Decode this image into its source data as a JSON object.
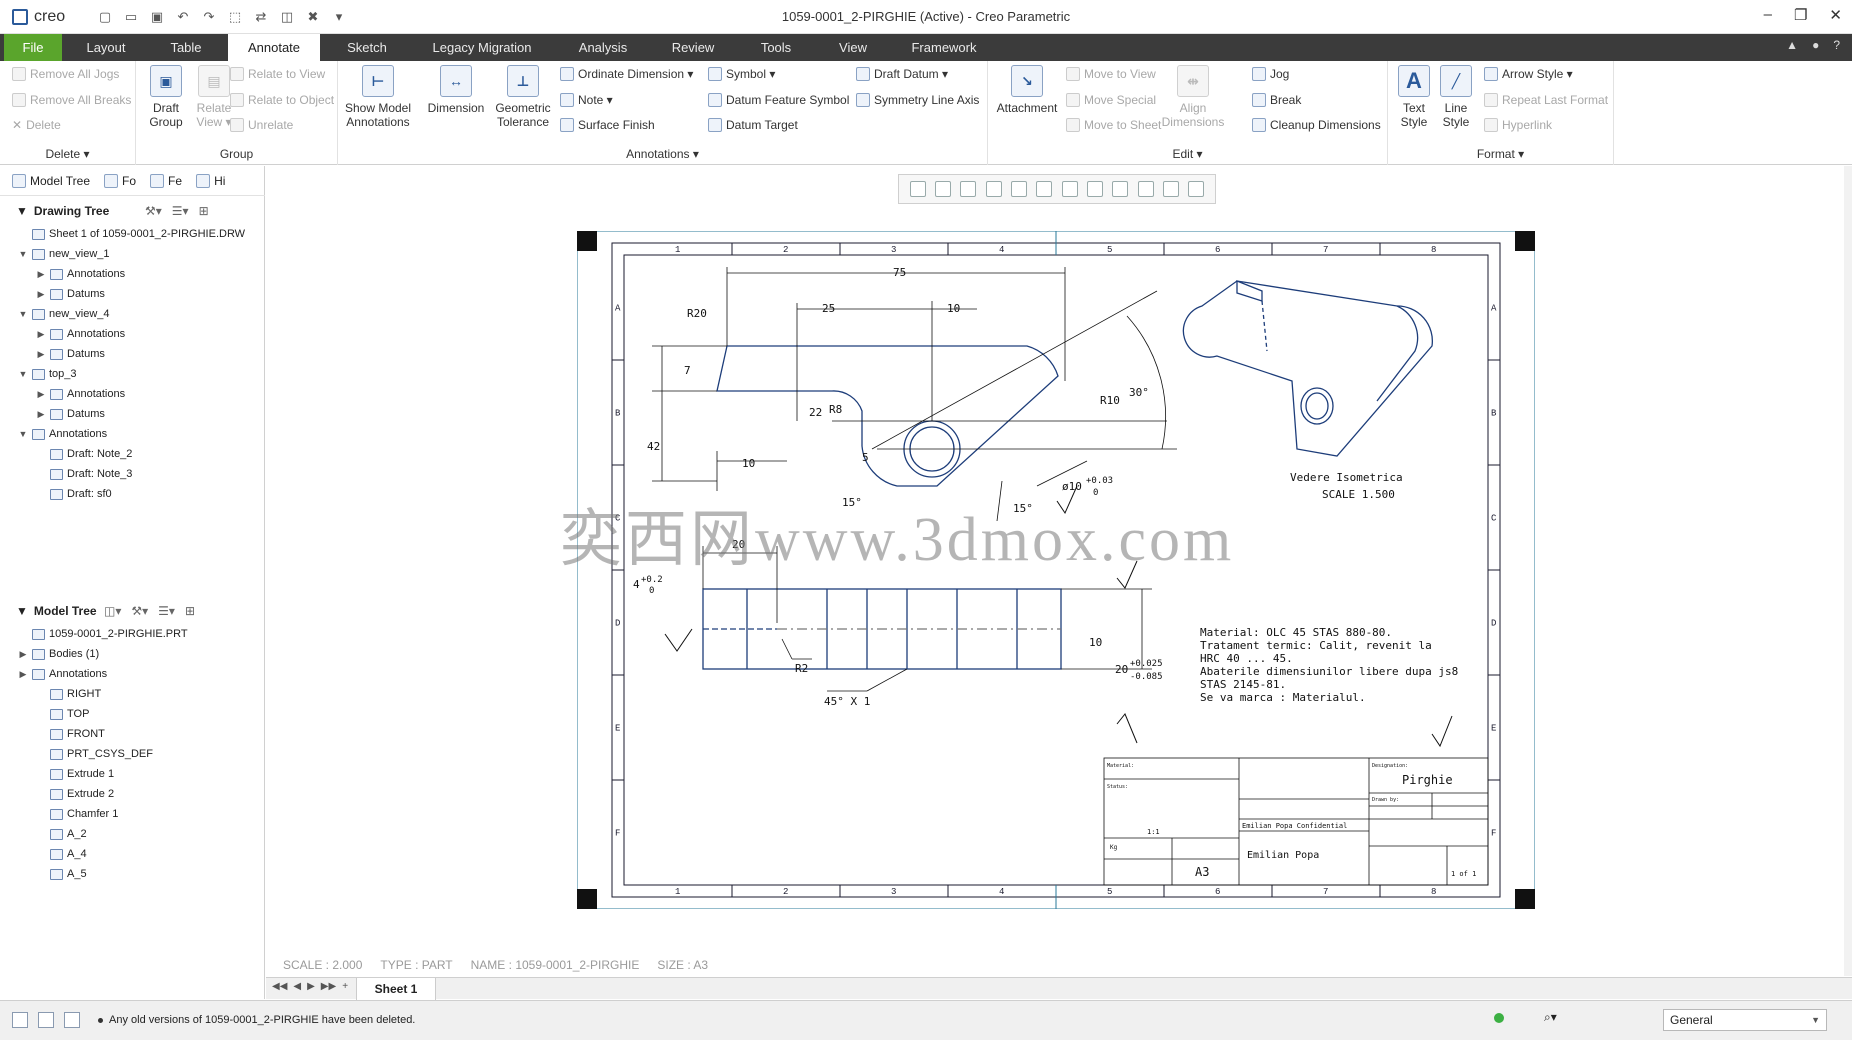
{
  "app": {
    "logo": "creo",
    "window_title": "1059-0001_2-PIRGHIE (Active) - Creo Parametric",
    "window_controls": [
      "–",
      "❐",
      "✕"
    ]
  },
  "tabs": [
    {
      "label": "File"
    },
    {
      "label": "Layout"
    },
    {
      "label": "Table"
    },
    {
      "label": "Annotate"
    },
    {
      "label": "Sketch"
    },
    {
      "label": "Legacy Migration"
    },
    {
      "label": "Analysis"
    },
    {
      "label": "Review"
    },
    {
      "label": "Tools"
    },
    {
      "label": "View"
    },
    {
      "label": "Framework"
    }
  ],
  "ribbon": {
    "delete": {
      "label": "Delete ▾",
      "items": [
        "Remove All Jogs",
        "Remove All Breaks",
        "Delete"
      ]
    },
    "group": {
      "label": "Group",
      "draft_group": "Draft Group",
      "relate_view": "Relate View ▾",
      "items": [
        "Relate to View",
        "Relate to Object",
        "Unrelate"
      ]
    },
    "annotations": {
      "label": "Annotations ▾",
      "show_model_annotations": "Show Model Annotations",
      "dimension": "Dimension",
      "geometric_tolerance": "Geometric Tolerance",
      "col1": [
        "Ordinate Dimension ▾",
        "Note ▾",
        "Surface Finish"
      ],
      "col2": [
        "Symbol ▾",
        "Datum Feature Symbol",
        "Datum Target"
      ],
      "col3": [
        "Draft Datum ▾",
        "Symmetry Line Axis"
      ]
    },
    "edit": {
      "label": "Edit ▾",
      "attachment": "Attachment",
      "move_items": [
        "Move to View",
        "Move Special",
        "Move to Sheet"
      ],
      "align_dimensions": "Align Dimensions",
      "items": [
        "Jog",
        "Break",
        "Cleanup Dimensions"
      ]
    },
    "format": {
      "label": "Format ▾",
      "text_style": "Text Style",
      "line_style": "Line Style",
      "items": [
        "Arrow Style ▾",
        "Repeat Last Format",
        "Hyperlink"
      ]
    }
  },
  "left_panel": {
    "tabs": [
      "Model Tree",
      "Fo",
      "Fe",
      "Hi"
    ],
    "drawing_tree": {
      "title": "Drawing Tree",
      "nodes": [
        {
          "label": "Sheet 1 of 1059-0001_2-PIRGHIE.DRW",
          "level": 0,
          "exp": ""
        },
        {
          "label": "new_view_1",
          "level": 0,
          "exp": "▼"
        },
        {
          "label": "Annotations",
          "level": 1,
          "exp": "▶"
        },
        {
          "label": "Datums",
          "level": 1,
          "exp": "▶"
        },
        {
          "label": "new_view_4",
          "level": 0,
          "exp": "▼"
        },
        {
          "label": "Annotations",
          "level": 1,
          "exp": "▶"
        },
        {
          "label": "Datums",
          "level": 1,
          "exp": "▶"
        },
        {
          "label": "top_3",
          "level": 0,
          "exp": "▼"
        },
        {
          "label": "Annotations",
          "level": 1,
          "exp": "▶"
        },
        {
          "label": "Datums",
          "level": 1,
          "exp": "▶"
        },
        {
          "label": "Annotations",
          "level": 0,
          "exp": "▼"
        },
        {
          "label": "Draft: Note_2",
          "level": 1,
          "exp": ""
        },
        {
          "label": "Draft: Note_3",
          "level": 1,
          "exp": ""
        },
        {
          "label": "Draft: sf0",
          "level": 1,
          "exp": ""
        }
      ]
    },
    "model_tree": {
      "title": "Model Tree",
      "nodes": [
        {
          "label": "1059-0001_2-PIRGHIE.PRT",
          "level": 0,
          "exp": ""
        },
        {
          "label": "Bodies (1)",
          "level": 0,
          "exp": "▶"
        },
        {
          "label": "Annotations",
          "level": 0,
          "exp": "▶"
        },
        {
          "label": "RIGHT",
          "level": 1,
          "exp": ""
        },
        {
          "label": "TOP",
          "level": 1,
          "exp": ""
        },
        {
          "label": "FRONT",
          "level": 1,
          "exp": ""
        },
        {
          "label": "PRT_CSYS_DEF",
          "level": 1,
          "exp": ""
        },
        {
          "label": "Extrude 1",
          "level": 1,
          "exp": ""
        },
        {
          "label": "Extrude 2",
          "level": 1,
          "exp": ""
        },
        {
          "label": "Chamfer 1",
          "level": 1,
          "exp": ""
        },
        {
          "label": "A_2",
          "level": 1,
          "exp": ""
        },
        {
          "label": "A_4",
          "level": 1,
          "exp": ""
        },
        {
          "label": "A_5",
          "level": 1,
          "exp": ""
        }
      ]
    }
  },
  "drawing": {
    "zones_top": [
      "1",
      "2",
      "3",
      "4",
      "5",
      "6",
      "7",
      "8"
    ],
    "zones_side": [
      "A",
      "B",
      "C",
      "D",
      "E",
      "F"
    ],
    "dims": {
      "d75": "75",
      "d25": "25",
      "d10a": "10",
      "r20": "R20",
      "d7": "7",
      "d42": "42",
      "d22": "22",
      "r8": "R8",
      "d10b": "10",
      "d5": "5",
      "d15a": "15°",
      "d15b": "15°",
      "r10": "R10",
      "d30": "30°",
      "phi10": "ø10",
      "phi_tol_up": "+0.03",
      "phi_tol_lo": "0",
      "d20": "20",
      "d4": "4",
      "d4_tol_up": "+0.2",
      "d4_tol_lo": "0",
      "r2": "R2",
      "chamfer": "45° X 1",
      "d10c": "10",
      "d20b": "20",
      "d20b_tol_up": "+0.025",
      "d20b_tol_lo": "-0.085"
    },
    "iso_caption_1": "Vedere Isometrica",
    "iso_caption_2": "SCALE 1.500",
    "notes": [
      "Material: OLC 45 STAS 880-80.",
      "Tratament termic: Calit, revenit la",
      "HRC 40 ... 45.",
      "Abaterile dimensiunilor libere dupa js8",
      "STAS 2145-81.",
      "Se va marca : Materialul."
    ],
    "title_block": {
      "part_name": "Pirghie",
      "author": "Emilian Popa",
      "confidential": "Emilian Popa Confidential",
      "size": "A3",
      "sheet": "1 of 1",
      "scale": "1:1",
      "material_label": "Material:",
      "status_label": "Status:",
      "designation_label": "Designation:",
      "drawn_by_label": "Drawn by:",
      "weight": "Kg"
    }
  },
  "watermark": "奕西网www.3dmox.com",
  "model_info": {
    "scale": "SCALE : 2.000",
    "type": "TYPE : PART",
    "name": "NAME : 1059-0001_2-PIRGHIE",
    "size": "SIZE : A3"
  },
  "sheet_tabs": {
    "nav": [
      "◀◀",
      "◀",
      "▶",
      "▶▶",
      "+"
    ],
    "current": "Sheet 1"
  },
  "status": {
    "message": "Any old versions of 1059-0001_2-PIRGHIE have been deleted.",
    "filter": "General"
  }
}
